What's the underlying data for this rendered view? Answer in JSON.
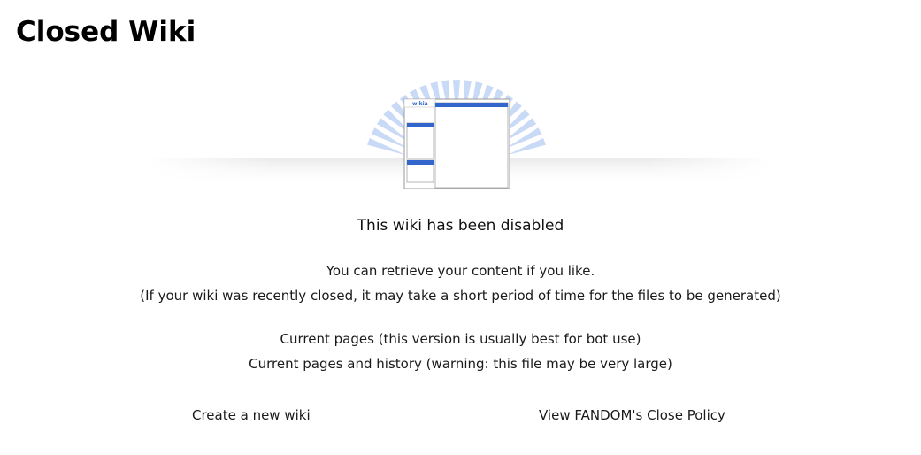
{
  "page": {
    "title": "Closed Wiki"
  },
  "illustration": {
    "logo_text": "wikia",
    "accent_color": "#3366cc",
    "ray_color": "#c9daf7"
  },
  "notice": {
    "headline": "This wiki has been disabled"
  },
  "retrieve": {
    "line1": "You can retrieve your content if you like.",
    "line2": "(If your wiki was recently closed, it may take a short period of time for the files to be generated)"
  },
  "downloads": {
    "current_pages": "Current pages (this version is usually best for bot use)",
    "pages_and_history": "Current pages and history (warning: this file may be very large)"
  },
  "footer_links": {
    "create": "Create a new wiki",
    "policy": "View FANDOM's Close Policy"
  }
}
